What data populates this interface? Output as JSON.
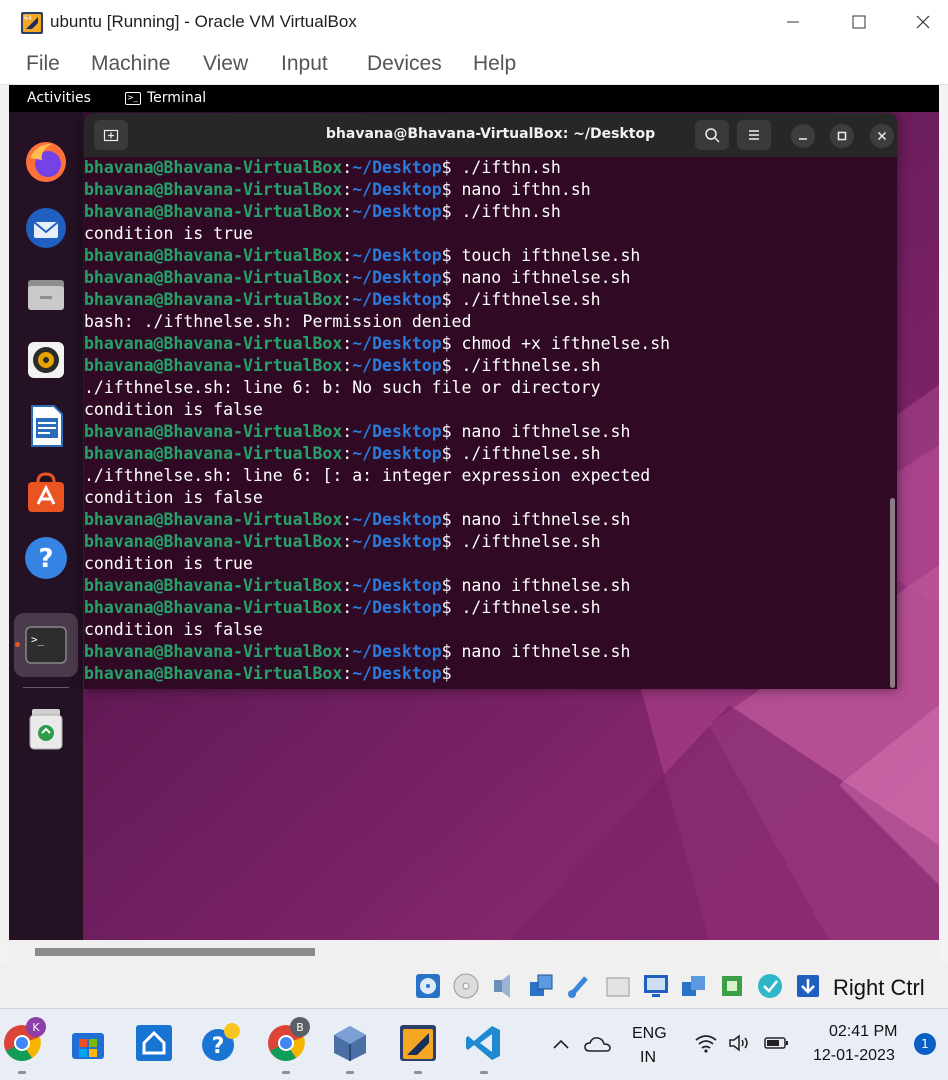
{
  "window": {
    "title": "ubuntu [Running] - Oracle VM VirtualBox",
    "menu": [
      "File",
      "Machine",
      "View",
      "Input",
      "Devices",
      "Help"
    ]
  },
  "guest": {
    "topbar": {
      "activities": "Activities",
      "app_name": "Terminal"
    },
    "dock_icons": [
      "firefox-icon",
      "thunderbird-icon",
      "files-icon",
      "rhythmbox-icon",
      "libreoffice-writer-icon",
      "ubuntu-software-icon",
      "help-icon",
      "terminal-icon",
      "trash-icon"
    ],
    "terminal": {
      "title": "bhavana@Bhavana-VirtualBox: ~/Desktop",
      "prompt_user": "bhavana@Bhavana-VirtualBox",
      "prompt_path": "~/Desktop",
      "lines": [
        {
          "type": "cmd",
          "text": " ./ifthn.sh"
        },
        {
          "type": "cmd",
          "text": " nano ifthn.sh"
        },
        {
          "type": "cmd",
          "text": " ./ifthn.sh"
        },
        {
          "type": "out",
          "text": "condition is true"
        },
        {
          "type": "cmd",
          "text": " touch ifthnelse.sh"
        },
        {
          "type": "cmd",
          "text": " nano ifthnelse.sh"
        },
        {
          "type": "cmd",
          "text": " ./ifthnelse.sh"
        },
        {
          "type": "out",
          "text": "bash: ./ifthnelse.sh: Permission denied"
        },
        {
          "type": "cmd",
          "text": " chmod +x ifthnelse.sh"
        },
        {
          "type": "cmd",
          "text": " ./ifthnelse.sh"
        },
        {
          "type": "out",
          "text": "./ifthnelse.sh: line 6: b: No such file or directory"
        },
        {
          "type": "out",
          "text": "condition is false"
        },
        {
          "type": "cmd",
          "text": " nano ifthnelse.sh"
        },
        {
          "type": "cmd",
          "text": " ./ifthnelse.sh"
        },
        {
          "type": "out",
          "text": "./ifthnelse.sh: line 6: [: a: integer expression expected"
        },
        {
          "type": "out",
          "text": "condition is false"
        },
        {
          "type": "cmd",
          "text": " nano ifthnelse.sh"
        },
        {
          "type": "cmd",
          "text": " ./ifthnelse.sh"
        },
        {
          "type": "out",
          "text": "condition is true"
        },
        {
          "type": "cmd",
          "text": " nano ifthnelse.sh"
        },
        {
          "type": "cmd",
          "text": " ./ifthnelse.sh"
        },
        {
          "type": "out",
          "text": "condition is false"
        },
        {
          "type": "cmd",
          "text": " nano ifthnelse.sh"
        },
        {
          "type": "cmd",
          "text": ""
        }
      ]
    }
  },
  "status": {
    "host_key": "Right Ctrl"
  },
  "taskbar": {
    "lang_top": "ENG",
    "lang_bottom": "IN",
    "time": "02:41 PM",
    "date": "12-01-2023",
    "notification_count": "1",
    "chrome_profile_1": "K",
    "chrome_profile_2": "B"
  }
}
